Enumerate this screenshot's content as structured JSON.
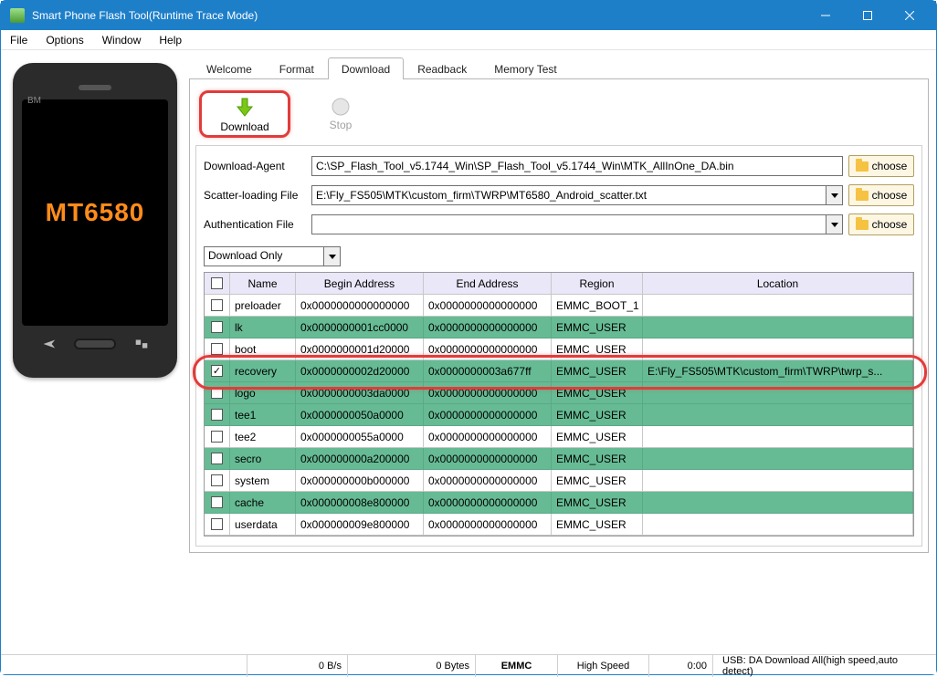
{
  "window": {
    "title": "Smart Phone Flash Tool(Runtime Trace Mode)"
  },
  "menus": [
    "File",
    "Options",
    "Window",
    "Help"
  ],
  "phone": {
    "chip": "MT6580",
    "brand": "BM"
  },
  "tabs": {
    "items": [
      "Welcome",
      "Format",
      "Download",
      "Readback",
      "Memory Test"
    ],
    "active_index": 2
  },
  "actions": {
    "download": "Download",
    "stop": "Stop"
  },
  "config": {
    "da_label": "Download-Agent",
    "da_value": "C:\\SP_Flash_Tool_v5.1744_Win\\SP_Flash_Tool_v5.1744_Win\\MTK_AllInOne_DA.bin",
    "scatter_label": "Scatter-loading File",
    "scatter_value": "E:\\Fly_FS505\\MTK\\custom_firm\\TWRP\\MT6580_Android_scatter.txt",
    "auth_label": "Authentication File",
    "auth_value": "",
    "choose": "choose",
    "mode": "Download Only"
  },
  "columns": [
    "",
    "Name",
    "Begin Address",
    "End Address",
    "Region",
    "Location"
  ],
  "rows": [
    {
      "checked": false,
      "green": false,
      "name": "preloader",
      "begin": "0x0000000000000000",
      "end": "0x0000000000000000",
      "region": "EMMC_BOOT_1",
      "location": ""
    },
    {
      "checked": false,
      "green": true,
      "name": "lk",
      "begin": "0x0000000001cc0000",
      "end": "0x0000000000000000",
      "region": "EMMC_USER",
      "location": ""
    },
    {
      "checked": false,
      "green": false,
      "name": "boot",
      "begin": "0x0000000001d20000",
      "end": "0x0000000000000000",
      "region": "EMMC_USER",
      "location": ""
    },
    {
      "checked": true,
      "green": true,
      "name": "recovery",
      "begin": "0x0000000002d20000",
      "end": "0x0000000003a677ff",
      "region": "EMMC_USER",
      "location": "E:\\Fly_FS505\\MTK\\custom_firm\\TWRP\\twrp_s..."
    },
    {
      "checked": false,
      "green": true,
      "name": "logo",
      "begin": "0x0000000003da0000",
      "end": "0x0000000000000000",
      "region": "EMMC_USER",
      "location": ""
    },
    {
      "checked": false,
      "green": true,
      "name": "tee1",
      "begin": "0x0000000050a0000",
      "end": "0x0000000000000000",
      "region": "EMMC_USER",
      "location": ""
    },
    {
      "checked": false,
      "green": false,
      "name": "tee2",
      "begin": "0x0000000055a0000",
      "end": "0x0000000000000000",
      "region": "EMMC_USER",
      "location": ""
    },
    {
      "checked": false,
      "green": true,
      "name": "secro",
      "begin": "0x000000000a200000",
      "end": "0x0000000000000000",
      "region": "EMMC_USER",
      "location": ""
    },
    {
      "checked": false,
      "green": false,
      "name": "system",
      "begin": "0x000000000b000000",
      "end": "0x0000000000000000",
      "region": "EMMC_USER",
      "location": ""
    },
    {
      "checked": false,
      "green": true,
      "name": "cache",
      "begin": "0x000000008e800000",
      "end": "0x0000000000000000",
      "region": "EMMC_USER",
      "location": ""
    },
    {
      "checked": false,
      "green": false,
      "name": "userdata",
      "begin": "0x000000009e800000",
      "end": "0x0000000000000000",
      "region": "EMMC_USER",
      "location": ""
    }
  ],
  "status": {
    "speed": "0 B/s",
    "bytes": "0 Bytes",
    "storage": "EMMC",
    "mode": "High Speed",
    "time": "0:00",
    "usb": "USB: DA Download All(high speed,auto detect)"
  }
}
